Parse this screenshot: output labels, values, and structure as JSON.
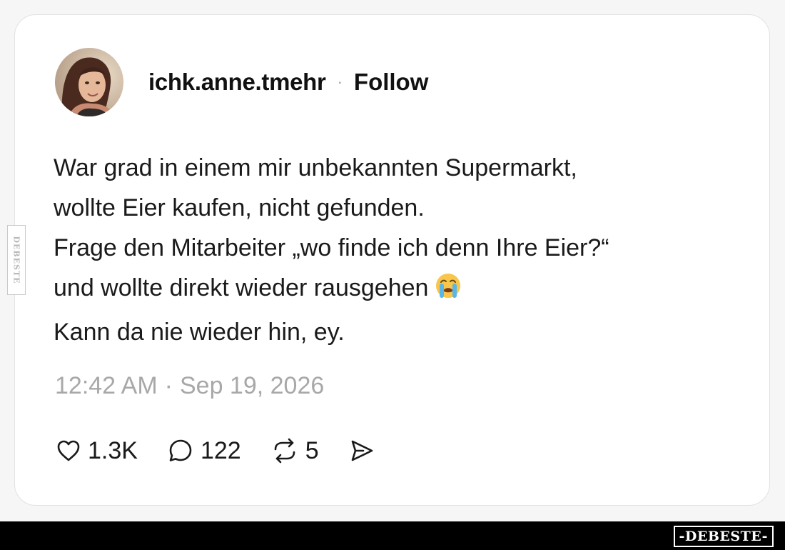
{
  "post": {
    "author": {
      "username": "ichk.anne.tmehr",
      "separator": "·",
      "follow_label": "Follow"
    },
    "text_lines": [
      "War grad in einem mir unbekannten Supermarkt,",
      "wollte Eier kaufen, nicht gefunden.",
      "Frage den Mitarbeiter „wo finde ich denn Ihre Eier?“",
      "und wollte direkt wieder rausgehen",
      "Kann da nie wieder hin, ey."
    ],
    "emoji": "loudly-crying-face",
    "timestamp": {
      "time": "12:42 AM",
      "separator": "·",
      "date": "Sep 19, 2026"
    },
    "actions": {
      "likes": "1.3K",
      "comments": "122",
      "reposts": "5"
    }
  },
  "watermark": {
    "side_text": "DEBESTE",
    "logo_text": "-DEBESTE-"
  },
  "colors": {
    "text": "#1a1a1a",
    "muted": "#a8a8a8",
    "card_border": "#e2e2e2",
    "bar": "#000000"
  }
}
